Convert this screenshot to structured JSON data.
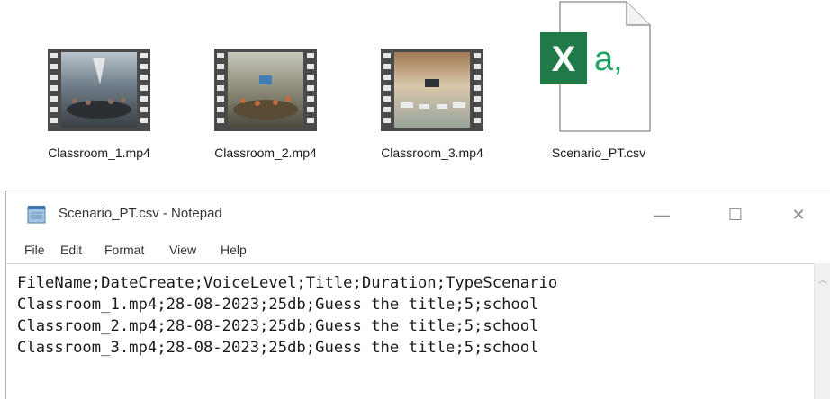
{
  "files": [
    {
      "name": "Classroom_1.mp4",
      "icon": "video-file-icon"
    },
    {
      "name": "Classroom_2.mp4",
      "icon": "video-file-icon"
    },
    {
      "name": "Classroom_3.mp4",
      "icon": "video-file-icon"
    },
    {
      "name": "Scenario_PT.csv",
      "icon": "excel-csv-file-icon"
    }
  ],
  "notepad": {
    "title": "Scenario_PT.csv - Notepad",
    "menu": [
      "File",
      "Edit",
      "Format",
      "View",
      "Help"
    ],
    "content": [
      "FileName;DateCreate;VoiceLevel;Title;Duration;TypeScenario",
      "Classroom_1.mp4;28-08-2023;25db;Guess the title;5;school",
      "Classroom_2.mp4;28-08-2023;25db;Guess the title;5;school",
      "Classroom_3.mp4;28-08-2023;25db;Guess the title;5;school"
    ],
    "window_controls": {
      "minimize": "—",
      "maximize": "☐",
      "close": "✕"
    }
  },
  "colors": {
    "excel_green": "#1f7a47",
    "excel_text": "#ffffff",
    "csv_accent": "#21a366",
    "film_strip": "#4a4a4a"
  }
}
